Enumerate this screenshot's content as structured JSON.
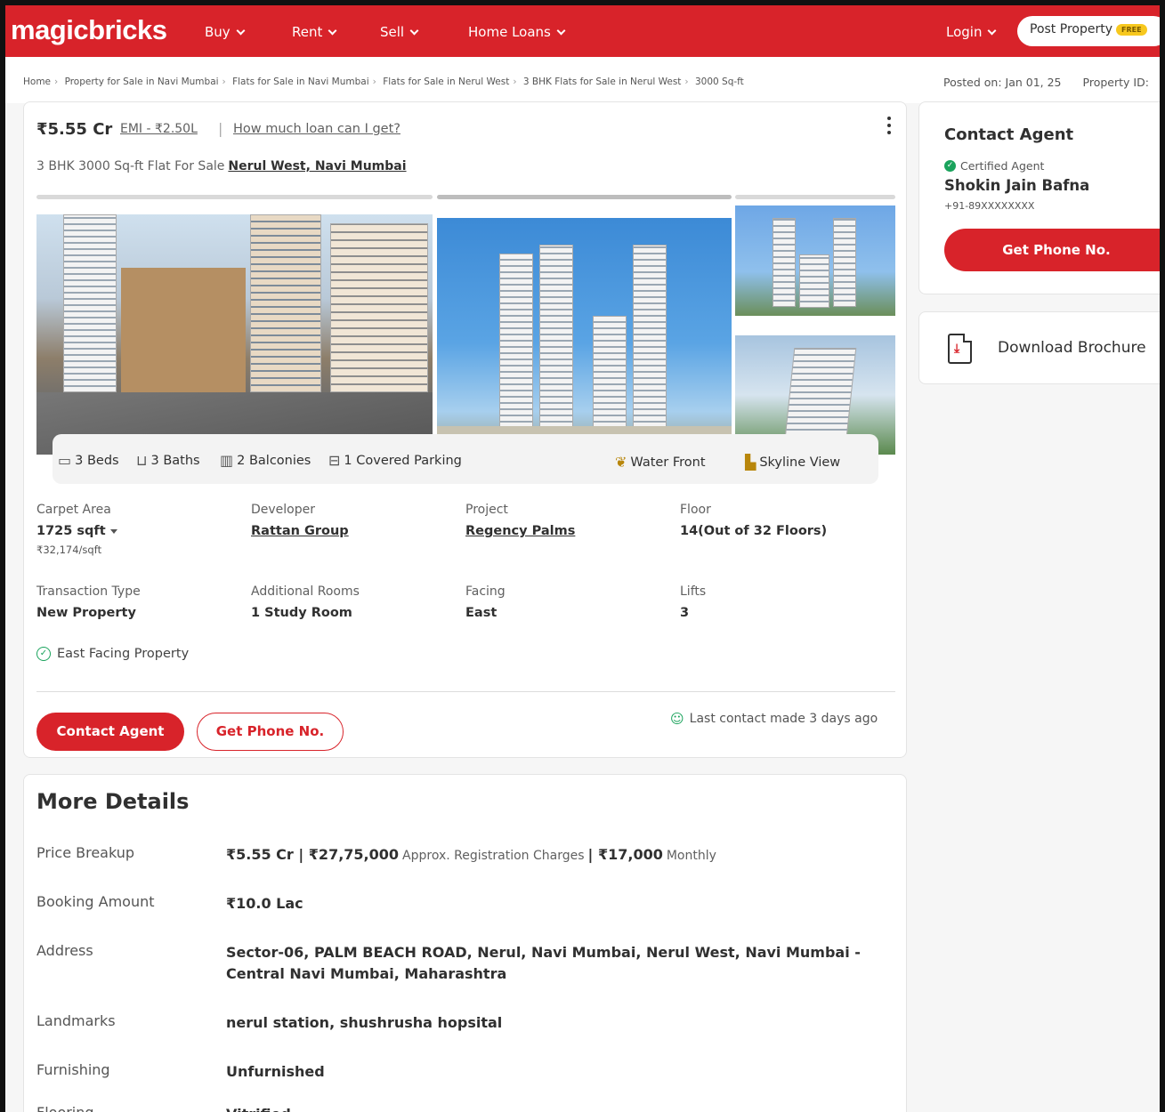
{
  "header": {
    "logo": "magicbricks",
    "nav": [
      "Buy",
      "Rent",
      "Sell",
      "Home Loans"
    ],
    "login": "Login",
    "post_property": "Post Property",
    "free_badge": "FREE"
  },
  "breadcrumb": [
    "Home",
    "Property for Sale in Navi Mumbai",
    "Flats for Sale in Navi Mumbai",
    "Flats for Sale in Nerul West",
    "3 BHK Flats for Sale in Nerul West",
    "3000 Sq-ft"
  ],
  "meta": {
    "posted_on": "Posted on: Jan 01, 25",
    "property_id": "Property ID:"
  },
  "listing": {
    "price": "₹5.55 Cr",
    "emi": "EMI - ₹2.50L",
    "separator": "|",
    "loan_link": "How much loan can I get?",
    "subtitle": "3 BHK 3000 Sq-ft Flat For Sale",
    "location": "Nerul West, Navi Mumbai"
  },
  "amenities": {
    "beds": "3 Beds",
    "baths": "3 Baths",
    "balconies": "2 Balconies",
    "parking": "1 Covered Parking",
    "water_front": "Water Front",
    "skyline": "Skyline View"
  },
  "specs": {
    "carpet_area_label": "Carpet Area",
    "carpet_area": "1725 sqft",
    "price_per_sqft": "₹32,174/sqft",
    "developer_label": "Developer",
    "developer": "Rattan Group",
    "project_label": "Project",
    "project": "Regency Palms",
    "floor_label": "Floor",
    "floor": "14(Out of 32 Floors)",
    "transaction_label": "Transaction Type",
    "transaction": "New Property",
    "rooms_label": "Additional Rooms",
    "rooms": "1 Study Room",
    "facing_label": "Facing",
    "facing": "East",
    "lifts_label": "Lifts",
    "lifts": "3"
  },
  "highlight": "East Facing Property",
  "actions": {
    "contact": "Contact Agent",
    "phone": "Get Phone No.",
    "last_contact": "Last contact made 3 days ago"
  },
  "details": {
    "title": "More Details",
    "price_breakup_label": "Price Breakup",
    "price_breakup_main": "₹5.55 Cr | ₹27,75,000",
    "price_breakup_reg": "Approx. Registration Charges",
    "price_breakup_monthly": "| ₹17,000",
    "price_breakup_monthly_label": "Monthly",
    "booking_label": "Booking Amount",
    "booking": "₹10.0 Lac",
    "address_label": "Address",
    "address": "Sector-06, PALM BEACH ROAD, Nerul, Navi Mumbai, Nerul West, Navi Mumbai - Central Navi Mumbai, Maharashtra",
    "landmarks_label": "Landmarks",
    "landmarks": "nerul station, shushrusha hopsital",
    "furnishing_label": "Furnishing",
    "furnishing": "Unfurnished",
    "flooring_label": "Flooring",
    "flooring": "Vitrified"
  },
  "agent": {
    "title": "Contact Agent",
    "certified": "Certified Agent",
    "name": "Shokin Jain Bafna",
    "phone": "+91-89XXXXXXXX",
    "button": "Get Phone No."
  },
  "brochure": {
    "label": "Download Brochure"
  },
  "colors": {
    "brand_red": "#d8232a",
    "green": "#1aa35c"
  }
}
